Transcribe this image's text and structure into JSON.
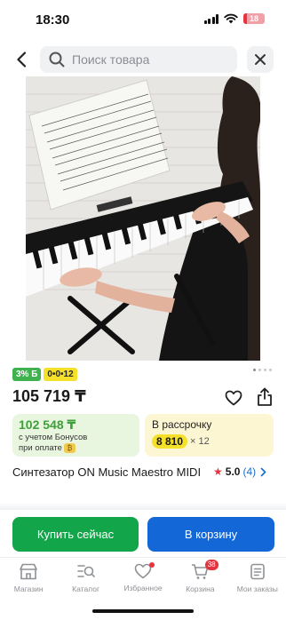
{
  "status_bar": {
    "time": "18:30",
    "battery": "18"
  },
  "search": {
    "placeholder": "Поиск товара",
    "value": ""
  },
  "product": {
    "badges": {
      "bonus": "3% Б",
      "installment": "0•0•12"
    },
    "price": "105 719 ₸",
    "bonus_price": {
      "amount": "102 548 ₸",
      "line1": "с учетом Бонусов",
      "line2": "при оплате"
    },
    "installment": {
      "label": "В рассрочку",
      "amount": "8 810",
      "multiplier": "× 12"
    },
    "title": "Синтезатор ON Music Maestro MIDI",
    "rating": {
      "score": "5.0",
      "count": "(4)"
    },
    "gallery": {
      "pages": 4,
      "current": 1
    }
  },
  "actions": {
    "buy_now": "Купить сейчас",
    "add_to_cart": "В корзину"
  },
  "tabbar": {
    "items": [
      {
        "label": "Магазин",
        "icon": "shop-icon"
      },
      {
        "label": "Каталог",
        "icon": "catalog-search-icon"
      },
      {
        "label": "Избранное",
        "icon": "heart-icon",
        "dot": true
      },
      {
        "label": "Корзина",
        "icon": "cart-icon",
        "badge": "38"
      },
      {
        "label": "Мои заказы",
        "icon": "orders-icon"
      }
    ]
  },
  "colors": {
    "buy_button": "#13a54a",
    "cart_button": "#1467d7",
    "bonus_badge": "#3fb24f",
    "installment_badge": "#f5e02a",
    "accent_red": "#e5343f"
  }
}
